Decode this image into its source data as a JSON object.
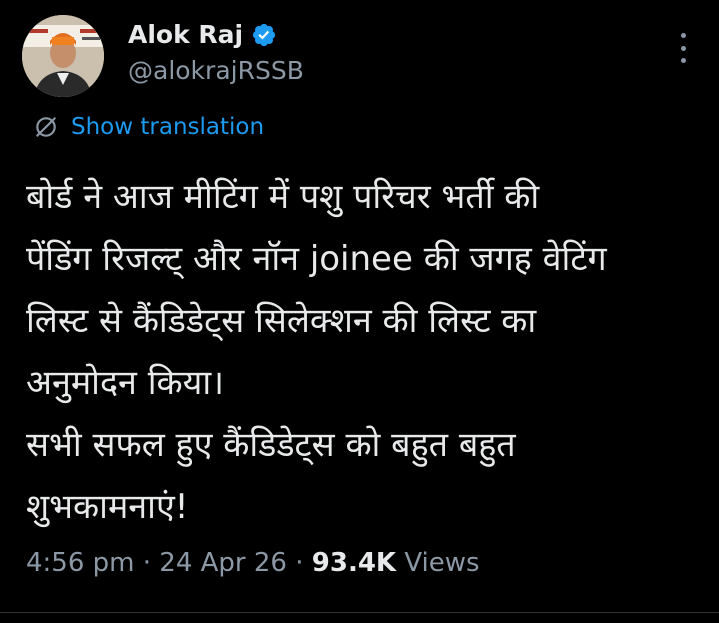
{
  "author": {
    "name": "Alok Raj",
    "handle": "@alokrajRSSB",
    "verified_color": "#1d9bf0"
  },
  "translate": {
    "icon": "globe-slash-icon",
    "label": "Show translation"
  },
  "tweet": {
    "lines": [
      "बोर्ड ने आज मीटिंग में पशु परिचर भर्ती की",
      "पेंडिंग रिजल्ट् और नॉन joinee की जगह वेटिंग",
      "लिस्ट से कैंडिडेट्स सिलेक्शन की लिस्ट का",
      "अनुमोदन किया।",
      "सभी सफल हुए कैंडिडेट्स को बहुत बहुत",
      "शुभकामनाएं!"
    ]
  },
  "meta": {
    "time": "4:56 pm",
    "sep1": " · ",
    "date": "24 Apr 26",
    "sep2": " · ",
    "views_count": "93.4K",
    "views_label": " Views"
  },
  "colors": {
    "background": "#000000",
    "text": "#e7e9ea",
    "secondary": "#8b98a5",
    "accent": "#1d9bf0"
  }
}
